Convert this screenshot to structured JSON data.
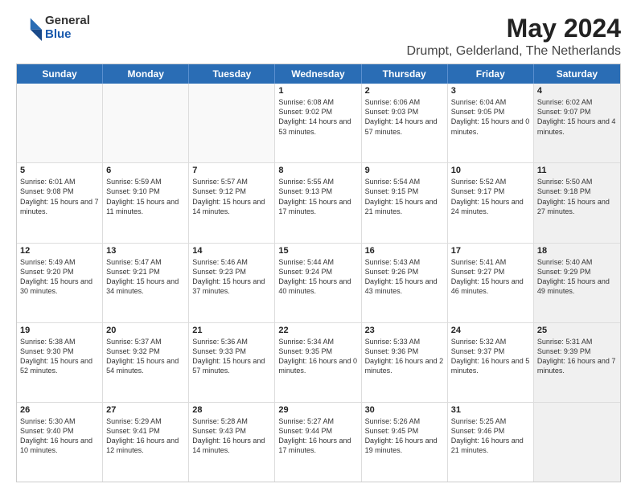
{
  "header": {
    "logo_general": "General",
    "logo_blue": "Blue",
    "main_title": "May 2024",
    "subtitle": "Drumpt, Gelderland, The Netherlands"
  },
  "calendar": {
    "days": [
      "Sunday",
      "Monday",
      "Tuesday",
      "Wednesday",
      "Thursday",
      "Friday",
      "Saturday"
    ],
    "weeks": [
      [
        {
          "day": "",
          "empty": true
        },
        {
          "day": "",
          "empty": true
        },
        {
          "day": "",
          "empty": true
        },
        {
          "day": "1",
          "sunrise": "Sunrise: 6:08 AM",
          "sunset": "Sunset: 9:02 PM",
          "daylight": "Daylight: 14 hours and 53 minutes."
        },
        {
          "day": "2",
          "sunrise": "Sunrise: 6:06 AM",
          "sunset": "Sunset: 9:03 PM",
          "daylight": "Daylight: 14 hours and 57 minutes."
        },
        {
          "day": "3",
          "sunrise": "Sunrise: 6:04 AM",
          "sunset": "Sunset: 9:05 PM",
          "daylight": "Daylight: 15 hours and 0 minutes."
        },
        {
          "day": "4",
          "sunrise": "Sunrise: 6:02 AM",
          "sunset": "Sunset: 9:07 PM",
          "daylight": "Daylight: 15 hours and 4 minutes.",
          "shaded": true
        }
      ],
      [
        {
          "day": "5",
          "sunrise": "Sunrise: 6:01 AM",
          "sunset": "Sunset: 9:08 PM",
          "daylight": "Daylight: 15 hours and 7 minutes."
        },
        {
          "day": "6",
          "sunrise": "Sunrise: 5:59 AM",
          "sunset": "Sunset: 9:10 PM",
          "daylight": "Daylight: 15 hours and 11 minutes."
        },
        {
          "day": "7",
          "sunrise": "Sunrise: 5:57 AM",
          "sunset": "Sunset: 9:12 PM",
          "daylight": "Daylight: 15 hours and 14 minutes."
        },
        {
          "day": "8",
          "sunrise": "Sunrise: 5:55 AM",
          "sunset": "Sunset: 9:13 PM",
          "daylight": "Daylight: 15 hours and 17 minutes."
        },
        {
          "day": "9",
          "sunrise": "Sunrise: 5:54 AM",
          "sunset": "Sunset: 9:15 PM",
          "daylight": "Daylight: 15 hours and 21 minutes."
        },
        {
          "day": "10",
          "sunrise": "Sunrise: 5:52 AM",
          "sunset": "Sunset: 9:17 PM",
          "daylight": "Daylight: 15 hours and 24 minutes."
        },
        {
          "day": "11",
          "sunrise": "Sunrise: 5:50 AM",
          "sunset": "Sunset: 9:18 PM",
          "daylight": "Daylight: 15 hours and 27 minutes.",
          "shaded": true
        }
      ],
      [
        {
          "day": "12",
          "sunrise": "Sunrise: 5:49 AM",
          "sunset": "Sunset: 9:20 PM",
          "daylight": "Daylight: 15 hours and 30 minutes."
        },
        {
          "day": "13",
          "sunrise": "Sunrise: 5:47 AM",
          "sunset": "Sunset: 9:21 PM",
          "daylight": "Daylight: 15 hours and 34 minutes."
        },
        {
          "day": "14",
          "sunrise": "Sunrise: 5:46 AM",
          "sunset": "Sunset: 9:23 PM",
          "daylight": "Daylight: 15 hours and 37 minutes."
        },
        {
          "day": "15",
          "sunrise": "Sunrise: 5:44 AM",
          "sunset": "Sunset: 9:24 PM",
          "daylight": "Daylight: 15 hours and 40 minutes."
        },
        {
          "day": "16",
          "sunrise": "Sunrise: 5:43 AM",
          "sunset": "Sunset: 9:26 PM",
          "daylight": "Daylight: 15 hours and 43 minutes."
        },
        {
          "day": "17",
          "sunrise": "Sunrise: 5:41 AM",
          "sunset": "Sunset: 9:27 PM",
          "daylight": "Daylight: 15 hours and 46 minutes."
        },
        {
          "day": "18",
          "sunrise": "Sunrise: 5:40 AM",
          "sunset": "Sunset: 9:29 PM",
          "daylight": "Daylight: 15 hours and 49 minutes.",
          "shaded": true
        }
      ],
      [
        {
          "day": "19",
          "sunrise": "Sunrise: 5:38 AM",
          "sunset": "Sunset: 9:30 PM",
          "daylight": "Daylight: 15 hours and 52 minutes."
        },
        {
          "day": "20",
          "sunrise": "Sunrise: 5:37 AM",
          "sunset": "Sunset: 9:32 PM",
          "daylight": "Daylight: 15 hours and 54 minutes."
        },
        {
          "day": "21",
          "sunrise": "Sunrise: 5:36 AM",
          "sunset": "Sunset: 9:33 PM",
          "daylight": "Daylight: 15 hours and 57 minutes."
        },
        {
          "day": "22",
          "sunrise": "Sunrise: 5:34 AM",
          "sunset": "Sunset: 9:35 PM",
          "daylight": "Daylight: 16 hours and 0 minutes."
        },
        {
          "day": "23",
          "sunrise": "Sunrise: 5:33 AM",
          "sunset": "Sunset: 9:36 PM",
          "daylight": "Daylight: 16 hours and 2 minutes."
        },
        {
          "day": "24",
          "sunrise": "Sunrise: 5:32 AM",
          "sunset": "Sunset: 9:37 PM",
          "daylight": "Daylight: 16 hours and 5 minutes."
        },
        {
          "day": "25",
          "sunrise": "Sunrise: 5:31 AM",
          "sunset": "Sunset: 9:39 PM",
          "daylight": "Daylight: 16 hours and 7 minutes.",
          "shaded": true
        }
      ],
      [
        {
          "day": "26",
          "sunrise": "Sunrise: 5:30 AM",
          "sunset": "Sunset: 9:40 PM",
          "daylight": "Daylight: 16 hours and 10 minutes."
        },
        {
          "day": "27",
          "sunrise": "Sunrise: 5:29 AM",
          "sunset": "Sunset: 9:41 PM",
          "daylight": "Daylight: 16 hours and 12 minutes."
        },
        {
          "day": "28",
          "sunrise": "Sunrise: 5:28 AM",
          "sunset": "Sunset: 9:43 PM",
          "daylight": "Daylight: 16 hours and 14 minutes."
        },
        {
          "day": "29",
          "sunrise": "Sunrise: 5:27 AM",
          "sunset": "Sunset: 9:44 PM",
          "daylight": "Daylight: 16 hours and 17 minutes."
        },
        {
          "day": "30",
          "sunrise": "Sunrise: 5:26 AM",
          "sunset": "Sunset: 9:45 PM",
          "daylight": "Daylight: 16 hours and 19 minutes."
        },
        {
          "day": "31",
          "sunrise": "Sunrise: 5:25 AM",
          "sunset": "Sunset: 9:46 PM",
          "daylight": "Daylight: 16 hours and 21 minutes."
        },
        {
          "day": "",
          "empty": true,
          "shaded": true
        }
      ]
    ]
  }
}
